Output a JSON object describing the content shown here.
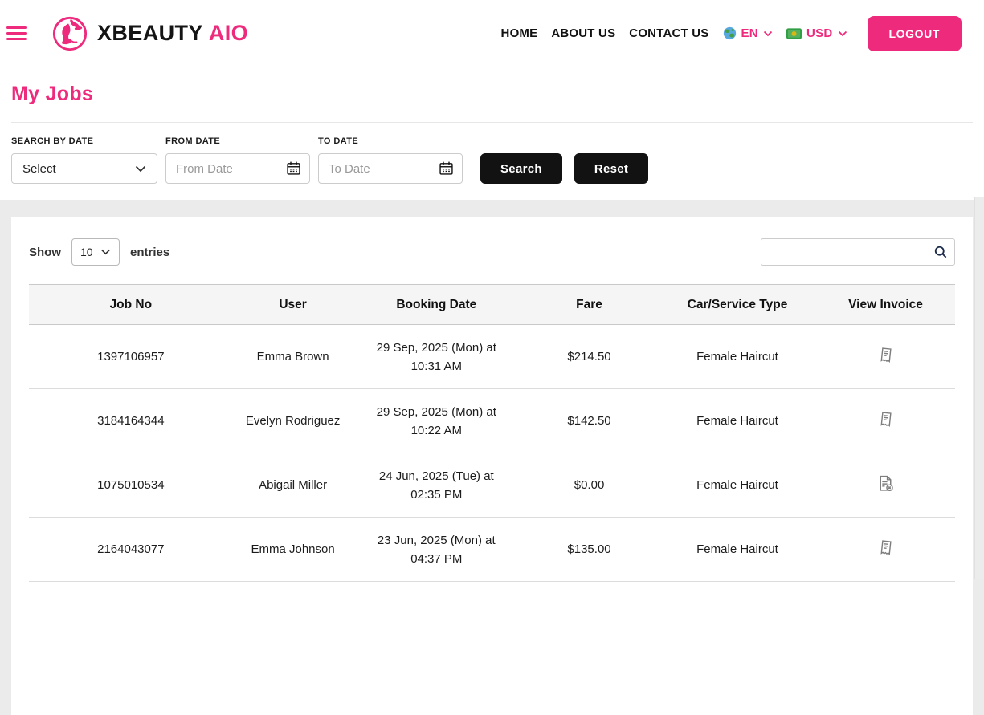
{
  "brand": {
    "name_primary": "XBEAUTY",
    "name_accent": "AIO"
  },
  "nav": {
    "items": [
      {
        "label": "HOME"
      },
      {
        "label": "ABOUT US"
      },
      {
        "label": "CONTACT US"
      }
    ],
    "language": "EN",
    "currency": "USD",
    "logout_label": "LOGOUT"
  },
  "page": {
    "title": "My Jobs"
  },
  "filters": {
    "search_by_date_label": "SEARCH BY DATE",
    "search_by_date_value": "Select",
    "from_date_label": "FROM DATE",
    "from_date_placeholder": "From Date",
    "to_date_label": "TO DATE",
    "to_date_placeholder": "To Date",
    "search_button": "Search",
    "reset_button": "Reset"
  },
  "table": {
    "show_label": "Show",
    "entries_per_page": "10",
    "entries_label": "entries",
    "search_value": "",
    "headers": [
      "Job No",
      "User",
      "Booking Date",
      "Fare",
      "Car/Service Type",
      "View Invoice"
    ],
    "rows": [
      {
        "job_no": "1397106957",
        "user": "Emma Brown",
        "date_line1": "29 Sep, 2025 (Mon) at",
        "date_line2": "10:31 AM",
        "fare": "$214.50",
        "service": "Female Haircut",
        "invoice_icon": "receipt-icon"
      },
      {
        "job_no": "3184164344",
        "user": "Evelyn Rodriguez",
        "date_line1": "29 Sep, 2025 (Mon) at",
        "date_line2": "10:22 AM",
        "fare": "$142.50",
        "service": "Female Haircut",
        "invoice_icon": "receipt-icon"
      },
      {
        "job_no": "1075010534",
        "user": "Abigail Miller",
        "date_line1": "24 Jun, 2025 (Tue) at",
        "date_line2": "02:35 PM",
        "fare": "$0.00",
        "service": "Female Haircut",
        "invoice_icon": "invoice-unavailable-icon"
      },
      {
        "job_no": "2164043077",
        "user": "Emma Johnson",
        "date_line1": "23 Jun, 2025 (Mon) at",
        "date_line2": "04:37 PM",
        "fare": "$135.00",
        "service": "Female Haircut",
        "invoice_icon": "receipt-icon"
      }
    ]
  },
  "colors": {
    "accent_pink": "#ee2a7c",
    "button_black": "#121212"
  }
}
